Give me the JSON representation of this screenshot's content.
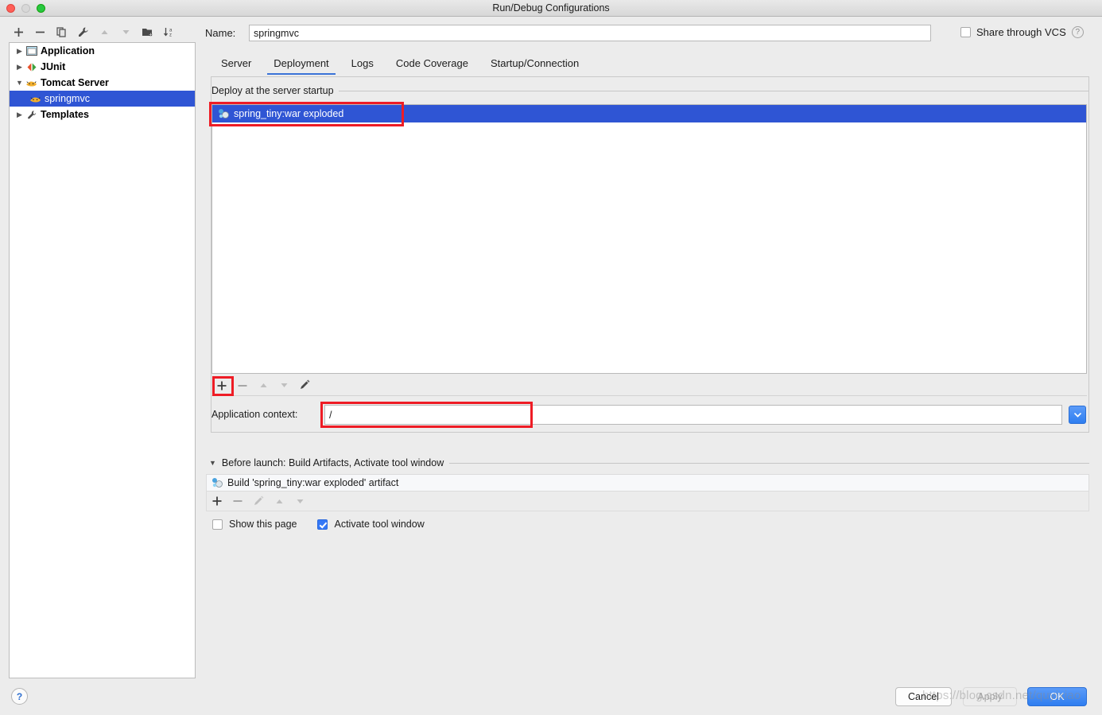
{
  "window": {
    "title": "Run/Debug Configurations",
    "traffic_lights": [
      "close",
      "minimize",
      "zoom"
    ]
  },
  "sidebar": {
    "toolbar": [
      {
        "name": "add-configuration",
        "glyph": "+",
        "enabled": true
      },
      {
        "name": "remove-configuration",
        "glyph": "−",
        "enabled": true
      },
      {
        "name": "copy-configuration",
        "glyph": "copy-icon",
        "enabled": true
      },
      {
        "name": "edit-templates",
        "glyph": "wrench-icon",
        "enabled": true
      },
      {
        "name": "move-up",
        "glyph": "▲",
        "enabled": false
      },
      {
        "name": "move-down",
        "glyph": "▼",
        "enabled": false
      },
      {
        "name": "new-folder",
        "glyph": "folder-add-icon",
        "enabled": true
      },
      {
        "name": "sort-alphabetically",
        "glyph": "sort-az-icon",
        "enabled": true
      }
    ],
    "tree": [
      {
        "label": "Application",
        "icon": "application-icon",
        "expanded": false,
        "selected": false,
        "child": false
      },
      {
        "label": "JUnit",
        "icon": "junit-icon",
        "expanded": false,
        "selected": false,
        "child": false
      },
      {
        "label": "Tomcat Server",
        "icon": "tomcat-icon",
        "expanded": true,
        "selected": false,
        "child": false
      },
      {
        "label": "springmvc",
        "icon": "tomcat-icon",
        "expanded": null,
        "selected": true,
        "child": true
      },
      {
        "label": "Templates",
        "icon": "templates-icon",
        "expanded": false,
        "selected": false,
        "child": false
      }
    ]
  },
  "header": {
    "name_label": "Name:",
    "name_value": "springmvc",
    "share_vcs_label": "Share through VCS",
    "share_vcs_checked": false,
    "help_glyph": "?"
  },
  "tabs": [
    {
      "label": "Server",
      "active": false
    },
    {
      "label": "Deployment",
      "active": true
    },
    {
      "label": "Logs",
      "active": false
    },
    {
      "label": "Code Coverage",
      "active": false
    },
    {
      "label": "Startup/Connection",
      "active": false
    }
  ],
  "deployment": {
    "group_label": "Deploy at the server startup",
    "artifacts": [
      {
        "label": "spring_tiny:war exploded",
        "icon": "artifact-icon",
        "selected": true
      }
    ],
    "list_toolbar": [
      {
        "name": "add-artifact",
        "glyph": "+",
        "enabled": true
      },
      {
        "name": "remove-artifact",
        "glyph": "−",
        "enabled": false
      },
      {
        "name": "move-artifact-up",
        "glyph": "▲",
        "enabled": false
      },
      {
        "name": "move-artifact-down",
        "glyph": "▼",
        "enabled": false
      },
      {
        "name": "edit-artifact",
        "glyph": "pencil-icon",
        "enabled": true
      }
    ],
    "context_label": "Application context:",
    "context_value": "/",
    "context_dropdown_glyph": "⌄"
  },
  "before_launch": {
    "title": "Before launch: Build Artifacts, Activate tool window",
    "expanded": true,
    "tasks": [
      {
        "label": "Build 'spring_tiny:war exploded' artifact",
        "icon": "artifact-icon"
      }
    ],
    "toolbar": [
      {
        "name": "add-task",
        "glyph": "+",
        "enabled": true
      },
      {
        "name": "remove-task",
        "glyph": "−",
        "enabled": false
      },
      {
        "name": "edit-task",
        "glyph": "pencil-icon",
        "enabled": false
      },
      {
        "name": "move-task-up",
        "glyph": "▲",
        "enabled": false
      },
      {
        "name": "move-task-down",
        "glyph": "▼",
        "enabled": false
      }
    ],
    "show_page_label": "Show this page",
    "show_page_checked": false,
    "activate_tool_window_label": "Activate tool window",
    "activate_tool_window_checked": true
  },
  "footer": {
    "help_glyph": "?",
    "cancel_label": "Cancel",
    "apply_label": "Apply",
    "apply_enabled": false,
    "ok_label": "OK"
  },
  "watermark": "https://blog.csdn.net/quyixiao",
  "colors": {
    "selection_blue": "#2f55d4",
    "accent_blue": "#3478f6",
    "tab_underline": "#3a73d8",
    "annotation_red": "#ee1c25",
    "window_bg": "#ececec"
  },
  "annotations": [
    {
      "name": "artifact-row-highlight",
      "target": "spring_tiny:war exploded"
    },
    {
      "name": "add-artifact-highlight",
      "target": "+"
    },
    {
      "name": "application-context-highlight",
      "target": "/"
    }
  ]
}
